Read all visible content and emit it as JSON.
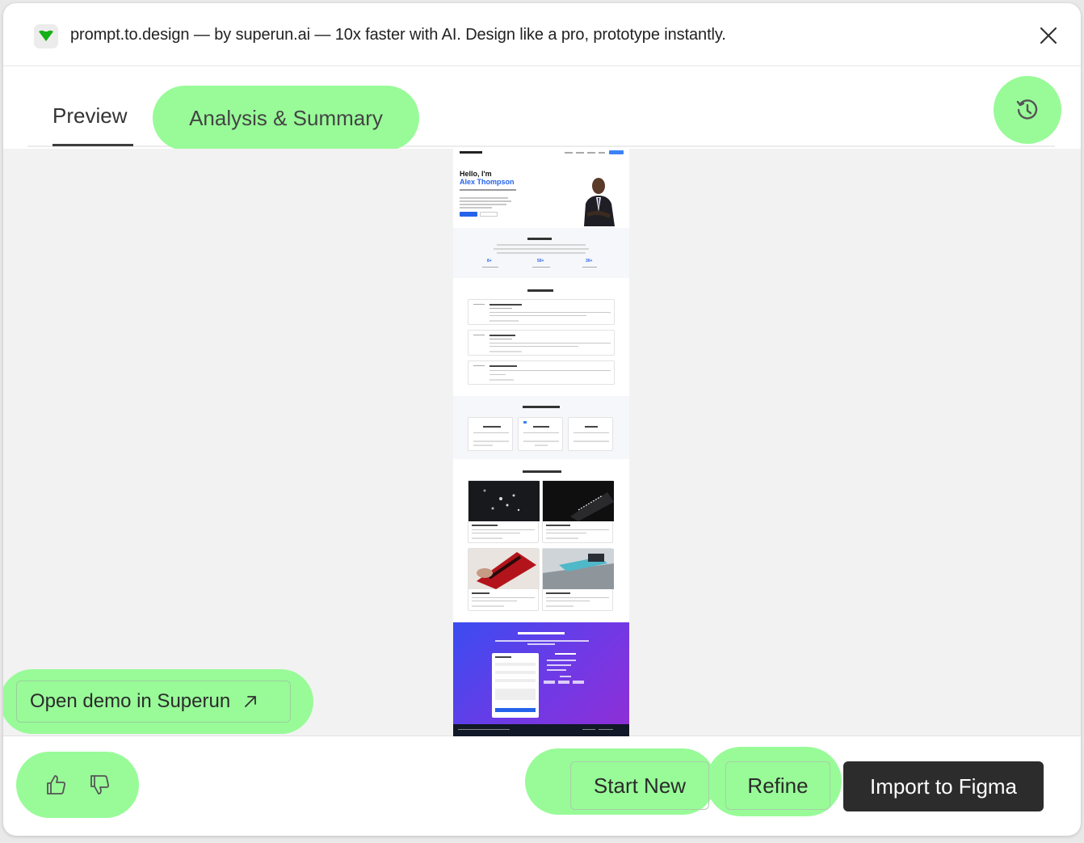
{
  "header": {
    "title": "prompt.to.design — by superun.ai — 10x faster with AI. Design like a pro, prototype instantly.",
    "logo_icon": "green-heart-icon",
    "close_icon": "close-icon"
  },
  "tabs": {
    "preview": "Preview",
    "analysis": "Analysis & Summary",
    "history_icon": "history-icon"
  },
  "preview_site": {
    "hero_line1": "Hello, I'm",
    "hero_line2": "Alex Thompson"
  },
  "actions": {
    "open_demo": "Open demo in Superun",
    "open_demo_icon": "arrow-up-right-icon",
    "thumbs_up_icon": "thumbs-up-icon",
    "thumbs_down_icon": "thumbs-down-icon",
    "start_new": "Start New",
    "refine": "Refine",
    "import_figma": "Import to Figma"
  },
  "colors": {
    "highlight": "#98fb98",
    "accent_green": "#22c55e",
    "primary_dark": "#2c2c2c",
    "preview_blue": "#2563eb"
  }
}
